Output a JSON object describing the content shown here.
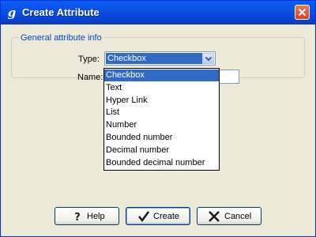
{
  "window": {
    "title": "Create Attribute",
    "app_icon_glyph": "g"
  },
  "group": {
    "legend": "General attribute info"
  },
  "type_field": {
    "label": "Type:",
    "value": "Checkbox",
    "options": [
      "Checkbox",
      "Text",
      "Hyper Link",
      "List",
      "Number",
      "Bounded number",
      "Decimal number",
      "Bounded decimal number"
    ],
    "selected_index": 0
  },
  "name_field": {
    "label": "Name:",
    "value": ""
  },
  "buttons": {
    "help": "Help",
    "create": "Create",
    "cancel": "Cancel"
  },
  "icons": {
    "close": "close-x-icon",
    "help": "question-mark-icon",
    "create": "checkmark-icon",
    "cancel": "x-icon",
    "dropdown": "chevron-down-icon"
  },
  "colors": {
    "title_bar": "#0a4ee3",
    "selection": "#316ac5",
    "legend_text": "#0046d5",
    "close_button": "#d6441f"
  }
}
